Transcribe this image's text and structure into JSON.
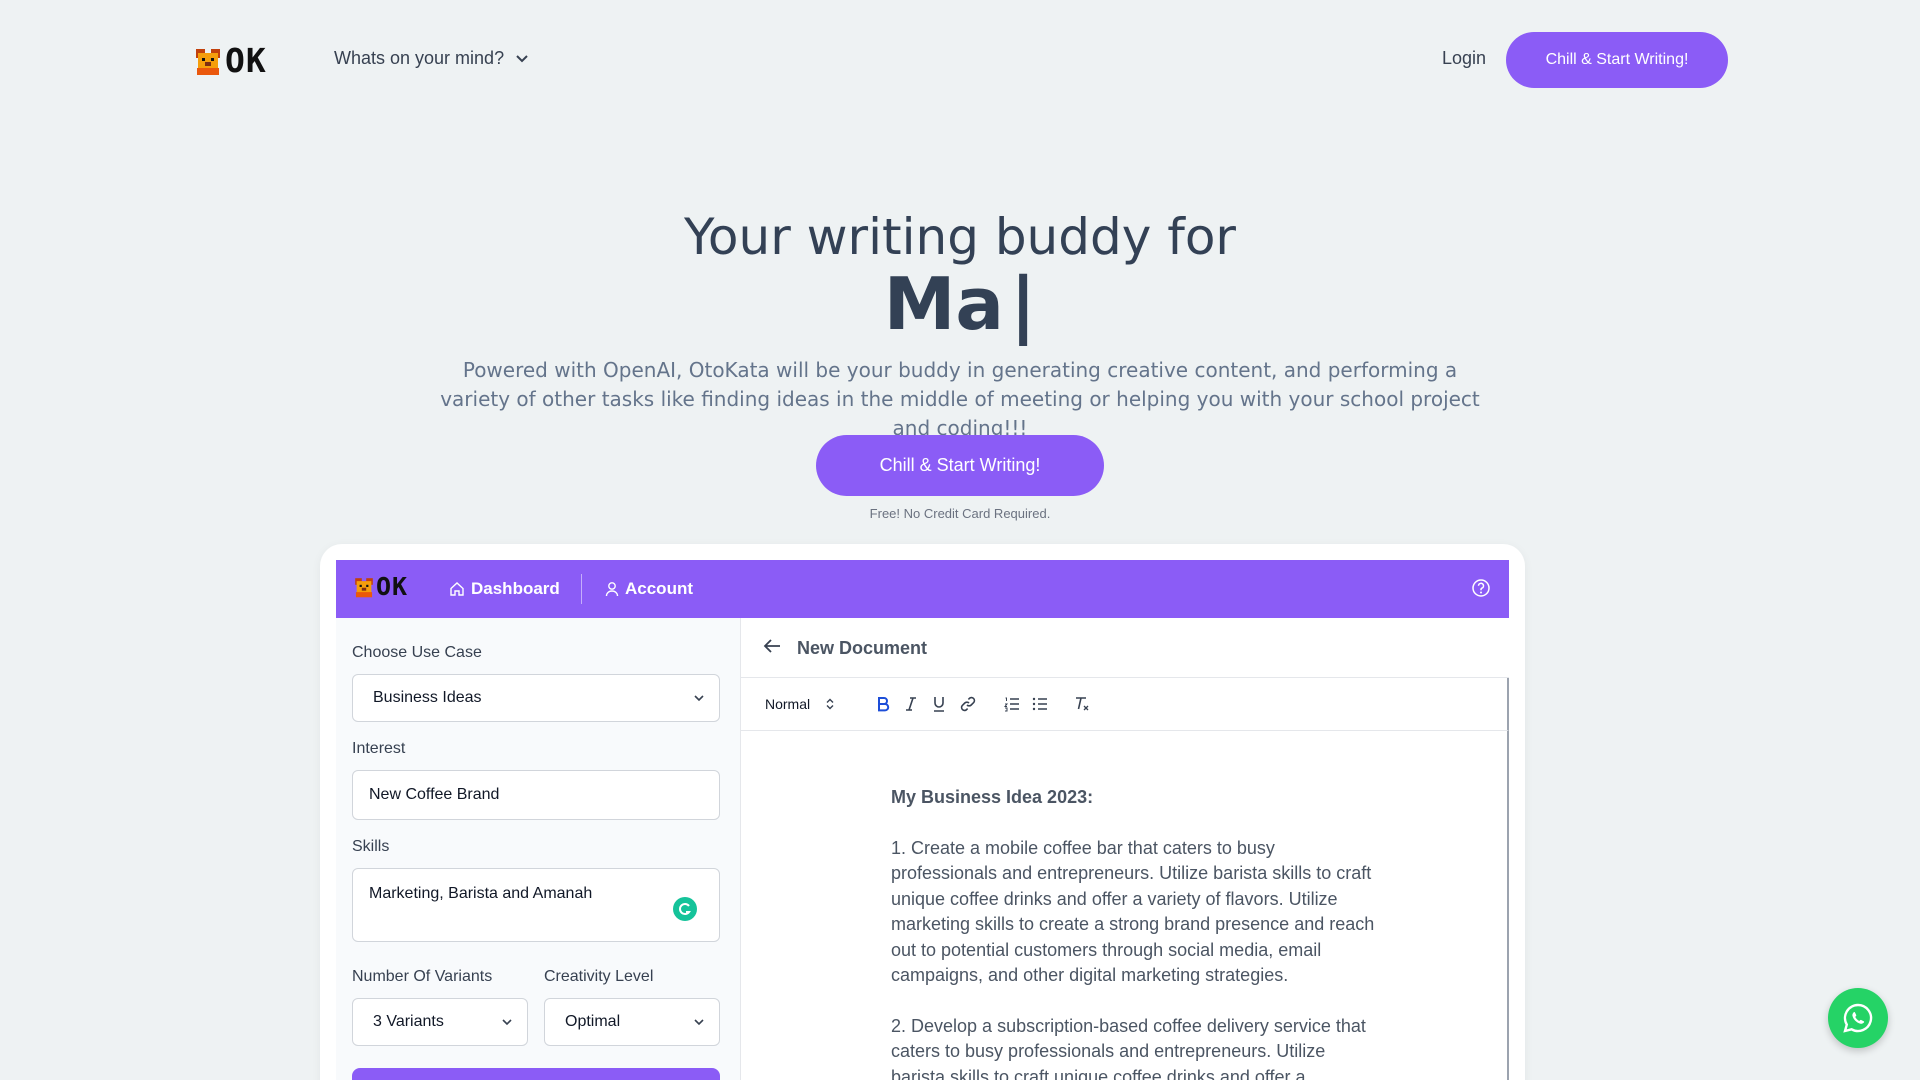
{
  "nav": {
    "logo_text": "OK",
    "menu_label": "Whats on your mind?",
    "login_label": "Login",
    "cta_label": "Chill & Start Writing!"
  },
  "hero": {
    "title": "Your writing buddy for",
    "typed_text": "Ma",
    "caret": "|",
    "description": "Powered with OpenAI, OtoKata will be your buddy in generating creative content, and performing a variety of other tasks like finding ideas in the middle of meeting or helping you with your school project and coding!!!",
    "cta_label": "Chill & Start Writing!",
    "note": "Free! No Credit Card Required."
  },
  "app": {
    "logo_text": "OK",
    "nav": {
      "dashboard_label": "Dashboard",
      "account_label": "Account"
    },
    "form": {
      "use_case_label": "Choose Use Case",
      "use_case_value": "Business Ideas",
      "interest_label": "Interest",
      "interest_value": "New Coffee Brand",
      "skills_label": "Skills",
      "skills_value": "Marketing, Barista and Amanah",
      "variants_label": "Number Of Variants",
      "variants_value": "3 Variants",
      "creativity_label": "Creativity Level",
      "creativity_value": "Optimal"
    },
    "editor": {
      "doc_title": "New Document",
      "format_value": "Normal",
      "heading": "My Business Idea 2023:",
      "paragraphs": [
        "1. Create a mobile coffee bar that caters to busy professionals and entrepreneurs. Utilize barista skills to craft unique coffee drinks and offer a variety of flavors. Utilize marketing skills to create a strong brand presence and reach out to potential customers through social media, email campaigns, and other digital marketing strategies.",
        "2. Develop a subscription-based coffee delivery service that caters to busy professionals and entrepreneurs. Utilize barista skills to craft unique coffee drinks and offer a"
      ]
    }
  },
  "colors": {
    "brand_purple": "#8b5cf6",
    "page_bg": "#eef2f3",
    "whatsapp_green": "#25d366"
  },
  "icons": [
    "dog-logo-icon",
    "chevron-down-icon",
    "home-icon",
    "user-icon",
    "help-icon",
    "arrow-left-icon",
    "bold-icon",
    "italic-icon",
    "underline-icon",
    "link-icon",
    "ordered-list-icon",
    "bullet-list-icon",
    "clear-format-icon",
    "grammarly-icon",
    "whatsapp-icon"
  ]
}
